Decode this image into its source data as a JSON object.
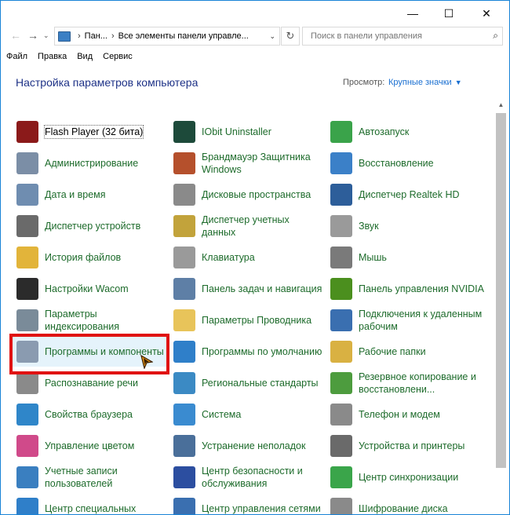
{
  "window": {
    "minimize": "—",
    "maximize": "☐",
    "close": "✕"
  },
  "address": {
    "crumb1": "Пан...",
    "crumb2": "Все элементы панели управле...",
    "search_placeholder": "Поиск в панели управления"
  },
  "menu": [
    "Файл",
    "Правка",
    "Вид",
    "Сервис"
  ],
  "header": {
    "title": "Настройка параметров компьютера",
    "view_label": "Просмотр:",
    "view_value": "Крупные значки"
  },
  "items": [
    {
      "label": "Flash Player (32 бита)",
      "icon": "flash-icon",
      "color": "#8b1a1a"
    },
    {
      "label": "IObit Uninstaller",
      "icon": "iobit-icon",
      "color": "#1d4a3a"
    },
    {
      "label": "Автозапуск",
      "icon": "autoplay-icon",
      "color": "#3aa34a"
    },
    {
      "label": "Администрирование",
      "icon": "admin-tools-icon",
      "color": "#7b8ea6"
    },
    {
      "label": "Брандмауэр Защитника Windows",
      "icon": "firewall-icon",
      "color": "#b5502c"
    },
    {
      "label": "Восстановление",
      "icon": "recovery-icon",
      "color": "#3b80c8"
    },
    {
      "label": "Дата и время",
      "icon": "datetime-icon",
      "color": "#6f8db0"
    },
    {
      "label": "Дисковые пространства",
      "icon": "storage-spaces-icon",
      "color": "#8a8a8a"
    },
    {
      "label": "Диспетчер Realtek HD",
      "icon": "realtek-icon",
      "color": "#2d5e9a"
    },
    {
      "label": "Диспетчер устройств",
      "icon": "device-manager-icon",
      "color": "#6a6a6a"
    },
    {
      "label": "Диспетчер учетных данных",
      "icon": "credential-icon",
      "color": "#c2a33b"
    },
    {
      "label": "Звук",
      "icon": "sound-icon",
      "color": "#9a9a9a"
    },
    {
      "label": "История файлов",
      "icon": "file-history-icon",
      "color": "#e2b43a"
    },
    {
      "label": "Клавиатура",
      "icon": "keyboard-icon",
      "color": "#9a9a9a"
    },
    {
      "label": "Мышь",
      "icon": "mouse-icon",
      "color": "#7a7a7a"
    },
    {
      "label": "Настройки Wacom",
      "icon": "wacom-icon",
      "color": "#2b2b2b"
    },
    {
      "label": "Панель задач и навигация",
      "icon": "taskbar-icon",
      "color": "#5e7fa6"
    },
    {
      "label": "Панель управления NVIDIA",
      "icon": "nvidia-icon",
      "color": "#4b8f1e"
    },
    {
      "label": "Параметры индексирования",
      "icon": "indexing-icon",
      "color": "#7a8b99"
    },
    {
      "label": "Параметры Проводника",
      "icon": "folder-options-icon",
      "color": "#e8c45a"
    },
    {
      "label": "Подключения к удаленным рабочим",
      "icon": "remote-desktop-icon",
      "color": "#3a6fb0"
    },
    {
      "label": "Программы и компоненты",
      "icon": "programs-icon",
      "color": "#8a9bb0"
    },
    {
      "label": "Программы по умолчанию",
      "icon": "default-programs-icon",
      "color": "#2f7fc9"
    },
    {
      "label": "Рабочие папки",
      "icon": "work-folders-icon",
      "color": "#d9b142"
    },
    {
      "label": "Распознавание речи",
      "icon": "speech-icon",
      "color": "#8a8a8a"
    },
    {
      "label": "Региональные стандарты",
      "icon": "region-icon",
      "color": "#3b8ac4"
    },
    {
      "label": "Резервное копирование и восстановлени...",
      "icon": "backup-icon",
      "color": "#4d9c3e"
    },
    {
      "label": "Свойства браузера",
      "icon": "browser-props-icon",
      "color": "#2f86c9"
    },
    {
      "label": "Система",
      "icon": "system-icon",
      "color": "#3a8bd0"
    },
    {
      "label": "Телефон и модем",
      "icon": "phone-modem-icon",
      "color": "#8a8a8a"
    },
    {
      "label": "Управление цветом",
      "icon": "color-mgmt-icon",
      "color": "#d04a8a"
    },
    {
      "label": "Устранение неполадок",
      "icon": "troubleshoot-icon",
      "color": "#4a6f9a"
    },
    {
      "label": "Устройства и принтеры",
      "icon": "printers-icon",
      "color": "#6a6a6a"
    },
    {
      "label": "Учетные записи пользователей",
      "icon": "user-accounts-icon",
      "color": "#3a7fc0"
    },
    {
      "label": "Центр безопасности и обслуживания",
      "icon": "security-center-icon",
      "color": "#2c4ea0"
    },
    {
      "label": "Центр синхронизации",
      "icon": "sync-center-icon",
      "color": "#3aa54a"
    },
    {
      "label": "Центр специальных",
      "icon": "ease-access-icon",
      "color": "#2f7fc9"
    },
    {
      "label": "Центр управления сетями",
      "icon": "network-center-icon",
      "color": "#3a6fb0"
    },
    {
      "label": "Шифрование диска",
      "icon": "bitlocker-icon",
      "color": "#8a8a8a"
    }
  ]
}
